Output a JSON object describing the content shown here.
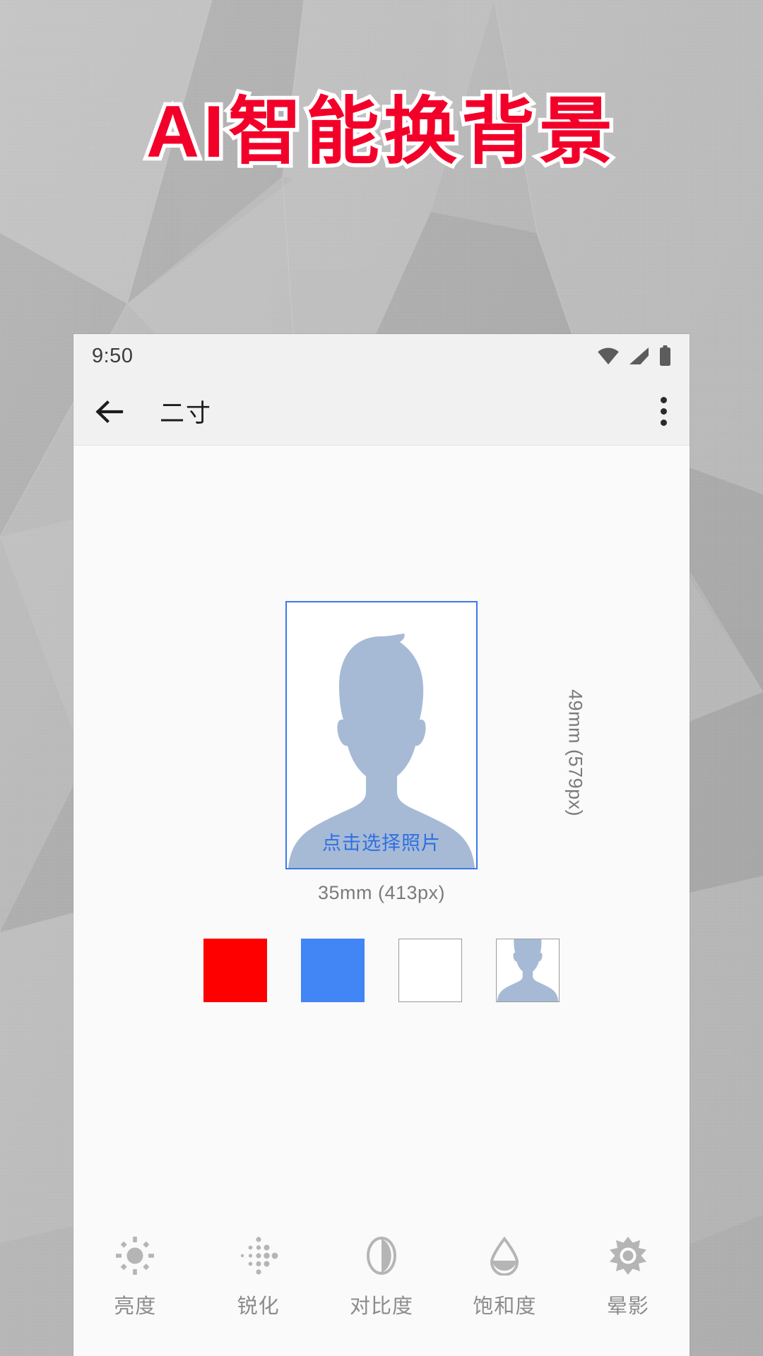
{
  "promo": {
    "headline": "AI智能换背景"
  },
  "phone": {
    "status_bar": {
      "time": "9:50",
      "icons": [
        "wifi-icon",
        "cellular-signal-icon",
        "battery-icon"
      ]
    },
    "app_bar": {
      "back_icon": "back-arrow-icon",
      "title": "二寸",
      "overflow_icon": "overflow-menu-icon"
    },
    "editor": {
      "photo_placeholder_hint": "点击选择照片",
      "width_label": "35mm (413px)",
      "height_label": "49mm (579px)",
      "avatar_icon": "person-silhouette-icon",
      "background_swatches": [
        {
          "name": "red",
          "color": "#FF0000",
          "type": "solid"
        },
        {
          "name": "blue",
          "color": "#4285F4",
          "type": "solid"
        },
        {
          "name": "white",
          "color": "#FFFFFF",
          "type": "solid"
        },
        {
          "name": "preview",
          "color": "#FFFFFF",
          "type": "thumbnail"
        }
      ],
      "tools": [
        {
          "icon": "brightness-icon",
          "label": "亮度"
        },
        {
          "icon": "sharpen-icon",
          "label": "锐化"
        },
        {
          "icon": "contrast-icon",
          "label": "对比度"
        },
        {
          "icon": "saturation-icon",
          "label": "饱和度"
        },
        {
          "icon": "vignette-icon",
          "label": "晕影"
        }
      ]
    }
  },
  "theme": {
    "headline_color": "#F3002A",
    "headline_outline": "#FFFFFF",
    "accent_blue": "#3B79E8",
    "silhouette": "#A6BAD6",
    "panel_bg": "#FAFAFA",
    "bar_bg": "#F1F1F1",
    "muted_text": "#7B7B7B"
  }
}
